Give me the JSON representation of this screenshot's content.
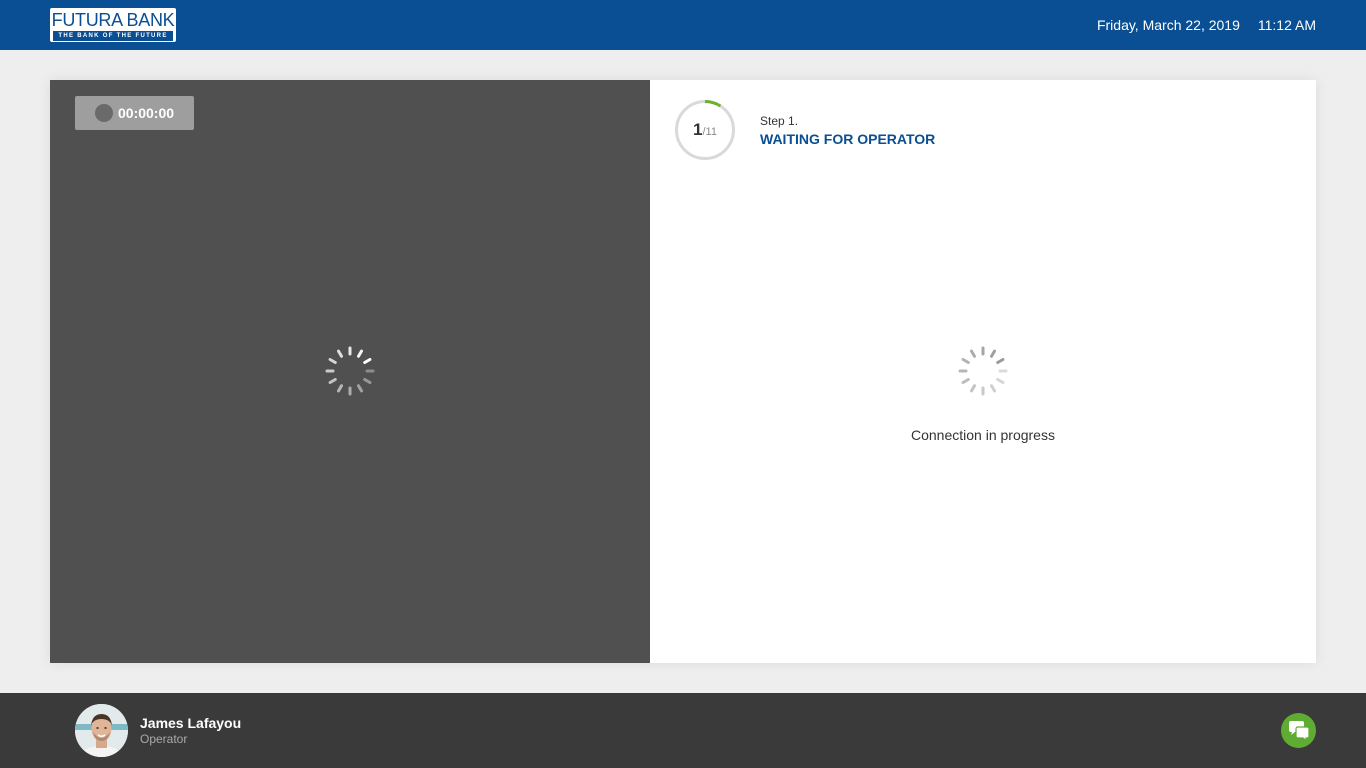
{
  "header": {
    "logo_title": "FUTURA BANK",
    "logo_tagline": "THE BANK OF THE FUTURE",
    "date": "Friday, March 22, 2019",
    "time": "11:12 AM"
  },
  "video": {
    "timer": "00:00:00",
    "timer_icon": "record-dot-icon",
    "loading_icon": "spinner-icon"
  },
  "step": {
    "current": "1",
    "total": "/11",
    "progress_fraction": 0.0909,
    "step_number": "Step 1.",
    "title": "WAITING FOR OPERATOR",
    "loading_icon": "spinner-icon",
    "status_text": "Connection in progress"
  },
  "operator": {
    "name": "James Lafayou",
    "role": "Operator",
    "avatar_icon": "operator-avatar"
  },
  "chat": {
    "icon": "chat-bubbles-icon"
  },
  "colors": {
    "brand_blue": "#0a4f93",
    "progress_green": "#6ab42d",
    "chat_green": "#5fac33",
    "video_bg": "#505050",
    "footer_bg": "#3a3a3a"
  }
}
